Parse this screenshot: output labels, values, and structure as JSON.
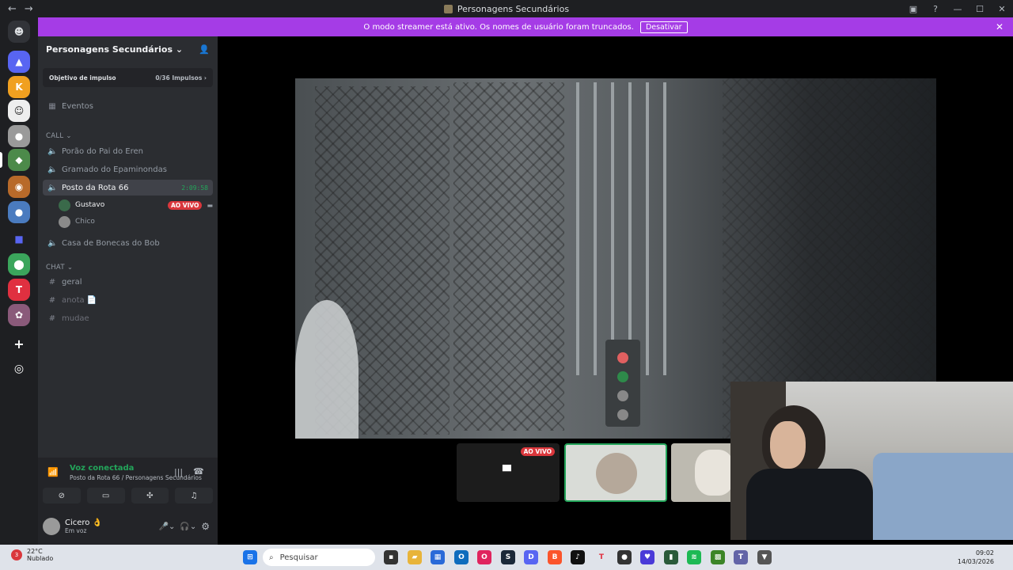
{
  "window": {
    "title": "Personagens Secundários",
    "back_icon": "←",
    "forward_icon": "→",
    "minimize": "—",
    "maximize": "☐",
    "close": "✕"
  },
  "banner": {
    "text": "O modo streamer está ativo. Os nomes de usuário foram truncados.",
    "button_label": "Desativar",
    "close": "✕",
    "color": "#a53ce6"
  },
  "server": {
    "name": "Personagens Secundários ⌄",
    "boost_label": "Objetivo de impulso",
    "boost_count": "0/36 Impulsos ›",
    "events_label": "Eventos",
    "categories": {
      "call": "CALL ⌄",
      "chat": "CHAT ⌄"
    },
    "voice_channels": [
      {
        "name": "Porão do Pai do Eren"
      },
      {
        "name": "Gramado do Epaminondas"
      },
      {
        "name": "Posto da Rota 66",
        "timer": "2:09:58"
      },
      {
        "name": "Casa de Bonecas do Bob"
      }
    ],
    "voice_users": [
      {
        "name": "Gustavo",
        "badge": "AO VIVO"
      },
      {
        "name": "Chico"
      }
    ],
    "text_channels": [
      {
        "name": "geral"
      },
      {
        "name": "anota 📄"
      },
      {
        "name": "mudae"
      }
    ]
  },
  "voice_panel": {
    "status": "Voz conectada",
    "location": "Posto da Rota 66 / Personagens Secundários"
  },
  "user": {
    "name": "Cicero 👌",
    "status": "Em voz"
  },
  "stage": {
    "live_badge": "AO VIVO"
  },
  "taskbar": {
    "weather_temp": "22°C",
    "weather_desc": "Nublado",
    "weather_alert": "3",
    "search_placeholder": "Pesquisar",
    "time": "09:02",
    "date": "14/03/2026"
  },
  "colors": {
    "accent_green": "#23a55a",
    "live_red": "#da373c",
    "discord_blurple": "#5865f2"
  }
}
